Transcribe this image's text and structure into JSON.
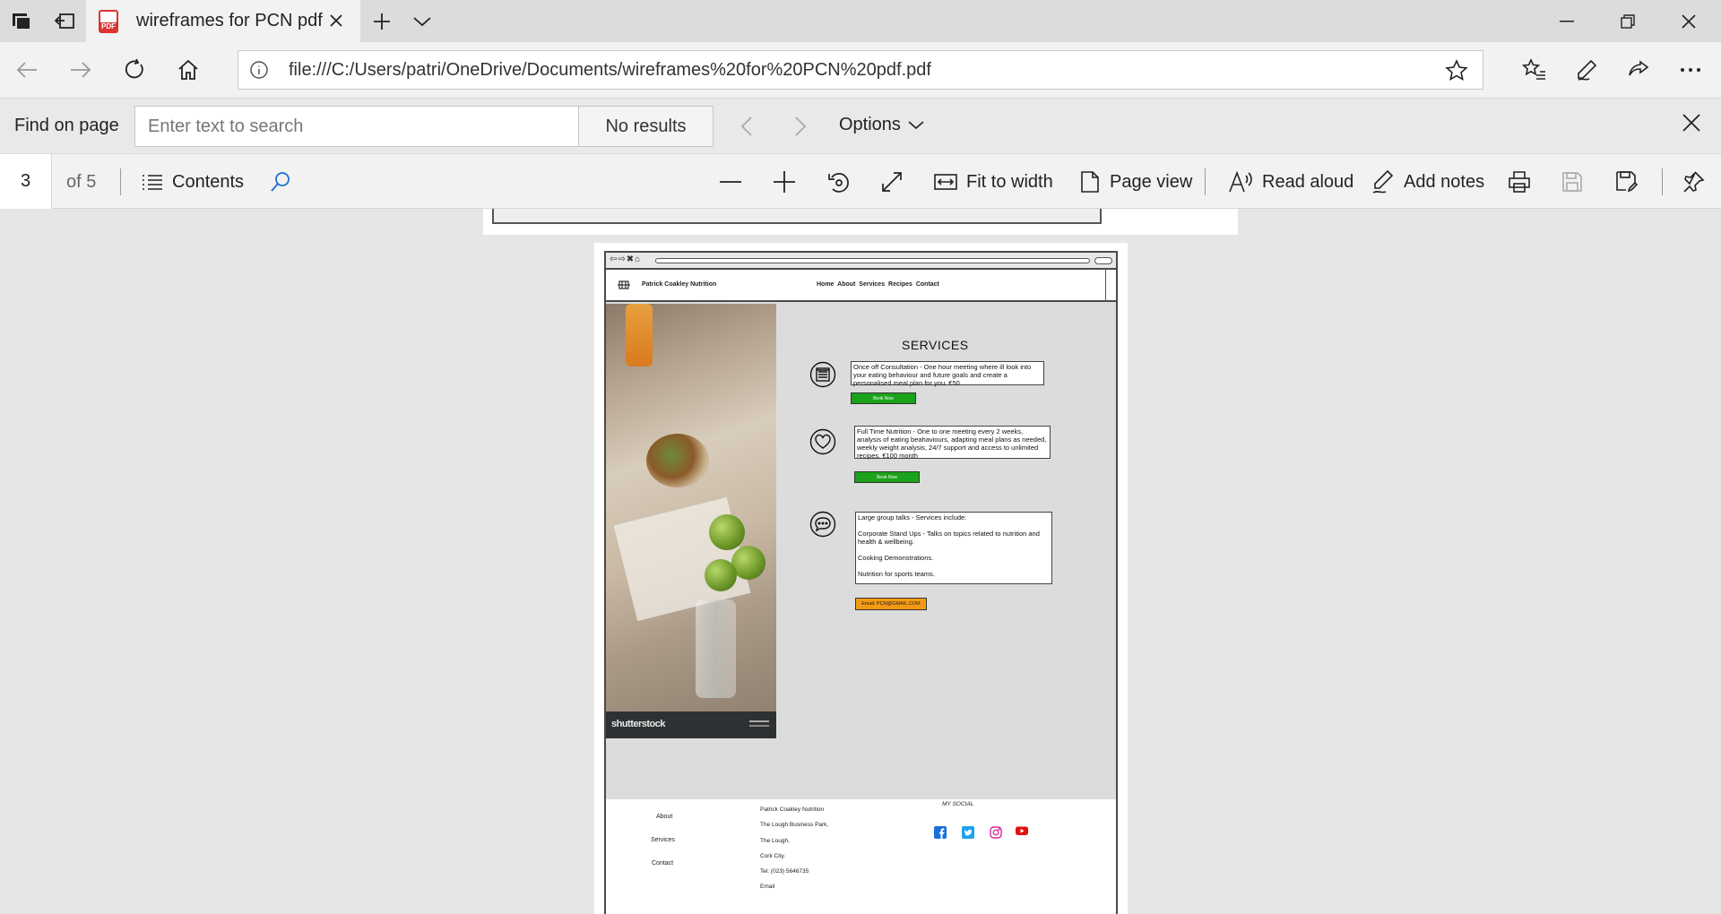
{
  "browser": {
    "tab_title": "wireframes for PCN pdf",
    "pdf_badge": "PDF",
    "url": "file:///C:/Users/patri/OneDrive/Documents/wireframes%20for%20PCN%20pdf.pdf"
  },
  "find_bar": {
    "label": "Find on page",
    "placeholder": "Enter text to search",
    "status": "No results",
    "options_label": "Options"
  },
  "pdf_toolbar": {
    "current_page": "3",
    "page_total": "of 5",
    "contents_label": "Contents",
    "fit_to_width_label": "Fit to width",
    "page_view_label": "Page view",
    "read_aloud_label": "Read aloud",
    "add_notes_label": "Add notes"
  },
  "wireframe": {
    "browser_glyphs": "⇦⇨✖⌂",
    "brand": "Patrick Coakley Nutrition",
    "nav": "Home  About  Services Recipes Contact",
    "photo_caption": "shutterstock",
    "title": "SERVICES",
    "services": [
      {
        "icon": "checklist-icon",
        "text": "Once off Consultation - One hour meeting where ill look into your eating behaviour and future goals and create a personalised meal plan for you.  €50",
        "button": "Book Now"
      },
      {
        "icon": "heart-icon",
        "text": "Full Time Nutrition - One to one meeting every 2 weeks, analysis of eating beahaviours, adapting meal plans as needed, weekly weight analysis, 24/7 support and access to unlimited recipes. €100 month",
        "button": "Book Now"
      },
      {
        "icon": "speech-bubble-icon",
        "heading": "Large group talks - Services include:",
        "items": [
          "Corporate Stand Ups - Talks on topics related to nutrition and health & wellbeing.",
          "Cooking Demonstrations.",
          "Nutrition for sports teams."
        ],
        "button": "Email: PCN@GMAIL.COM"
      }
    ],
    "footer": {
      "links": [
        "About",
        "Services",
        "Contact"
      ],
      "address": [
        "Patrick Coakley Nutrition",
        "The Lough Business Park,",
        "The Lough,",
        "Cork City.",
        "Tel: (023) 5646735",
        "Email"
      ],
      "social_title": "MY SOCIAL",
      "social_icons": [
        "facebook-icon",
        "twitter-icon",
        "instagram-icon",
        "youtube-icon"
      ]
    }
  },
  "colors": {
    "book_button": "#1aa31a",
    "email_button": "#f39a14",
    "facebook": "#1b6fd8",
    "twitter": "#1da1f2",
    "instagram": "#d62a9a",
    "youtube": "#e01010",
    "link_blue": "#1e6fd0"
  }
}
